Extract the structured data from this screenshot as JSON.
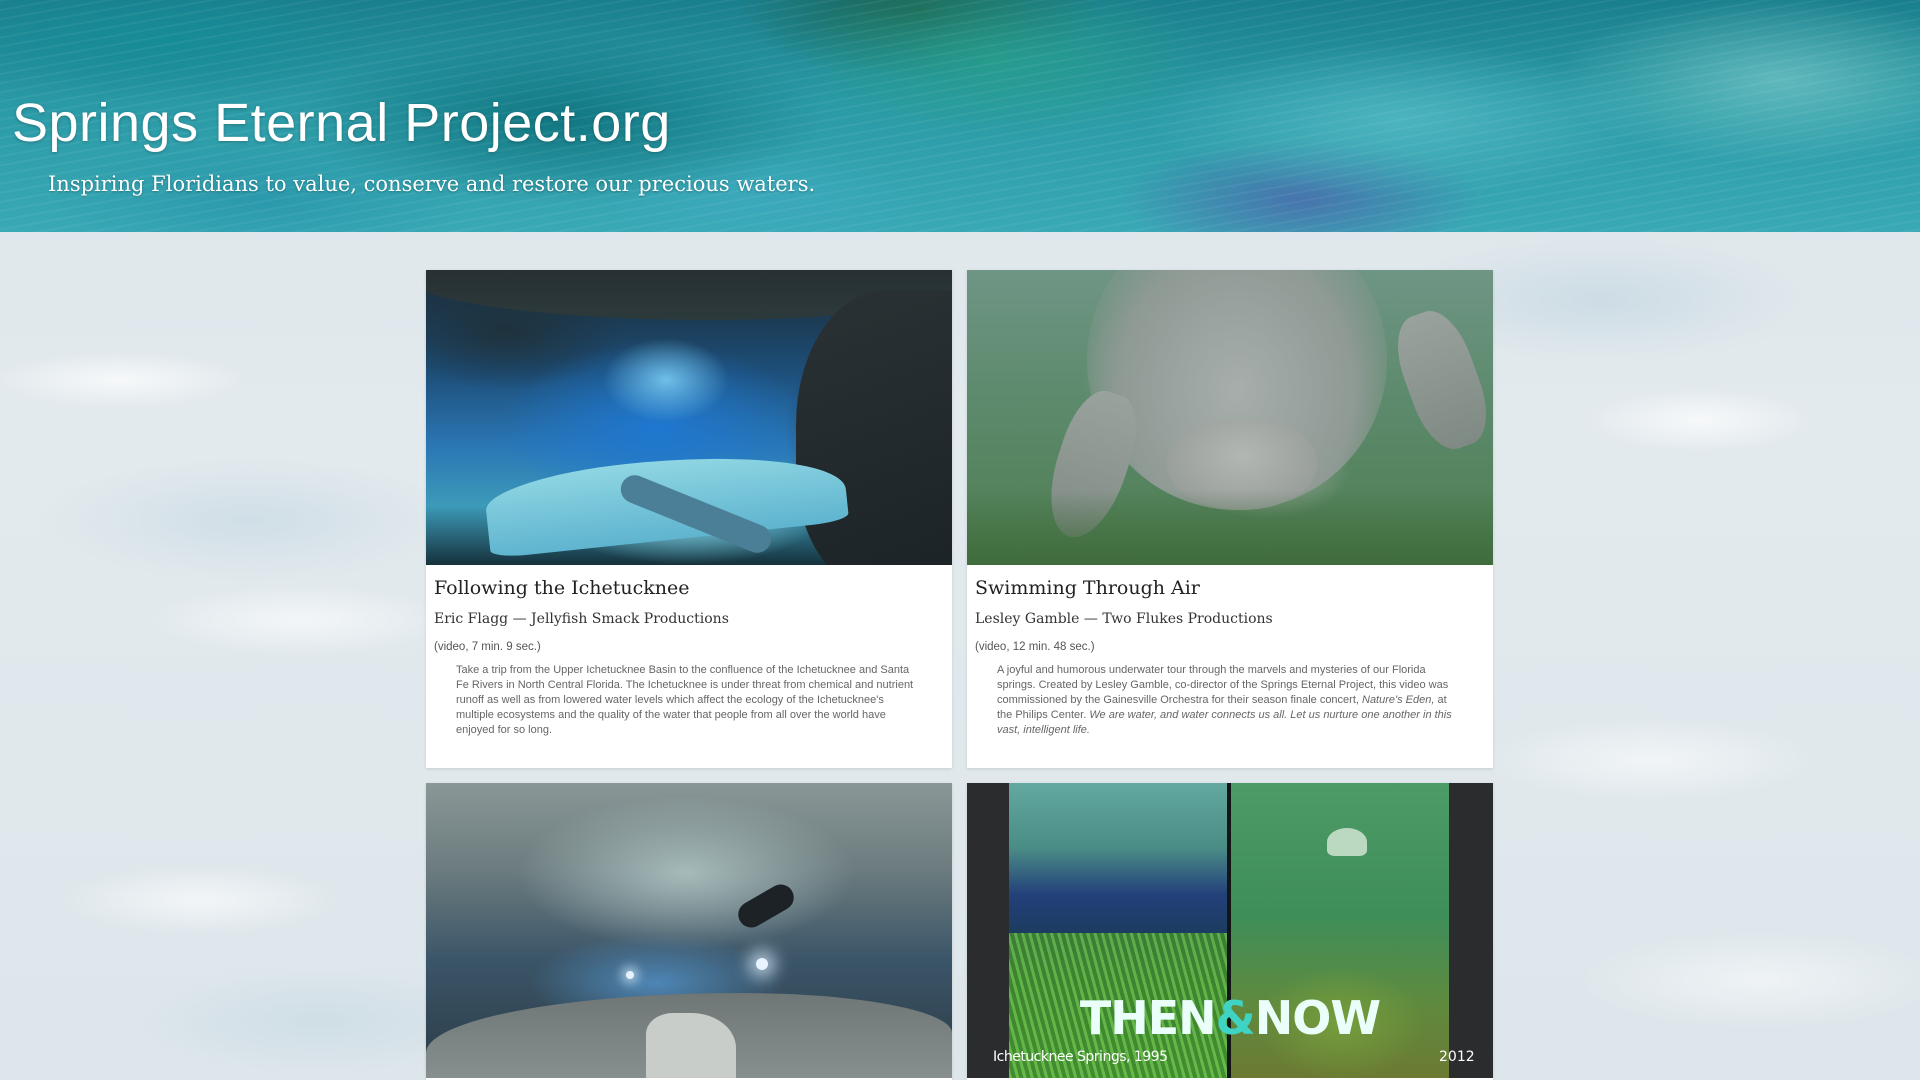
{
  "header": {
    "site_title": "Springs Eternal Project.org",
    "tagline": "Inspiring Floridians to value, conserve and restore our precious waters."
  },
  "cards": [
    {
      "title": "Following the Ichetucknee",
      "author": "Eric Flagg — Jellyfish Smack Productions",
      "duration": "(video, 7 min. 9 sec.)",
      "description": "Take a trip from the Upper Ichetucknee Basin to the confluence of the Ichetucknee and Santa Fe Rivers in North Central Florida. The Ichetucknee is under threat from chemical and nutrient runoff as well as from lowered water levels which affect the ecology of the Ichetucknee's multiple ecosystems and the quality of the water that people from all over the world have enjoyed for so long.",
      "thumbnail_icon": "underwater-cave-image"
    },
    {
      "title": "Swimming Through Air",
      "author": "Lesley Gamble — Two Flukes Productions",
      "duration": "(video, 12 min. 48 sec.)",
      "description_part1": "A joyful and humorous underwater tour through the marvels and mysteries of our Florida springs. Created by Lesley Gamble, co-director of the Springs Eternal Project, this video was commissioned by the Gainesville Orchestra for their season finale concert, ",
      "description_em1": "Nature's Eden,",
      "description_part2": " at the Philips Center. ",
      "description_em2": "We are water, and water connects us all. Let us nurture one another in this vast, intelligent life.",
      "thumbnail_icon": "manatee-image"
    },
    {
      "thumbnail_icon": "cave-diver-image"
    },
    {
      "thumbnail_icon": "then-and-now-image",
      "overlay_title_then": "THEN",
      "overlay_title_amp": "&",
      "overlay_title_now": "NOW",
      "caption_left": "Ichetucknee Springs, 1995",
      "caption_right": "2012"
    }
  ]
}
